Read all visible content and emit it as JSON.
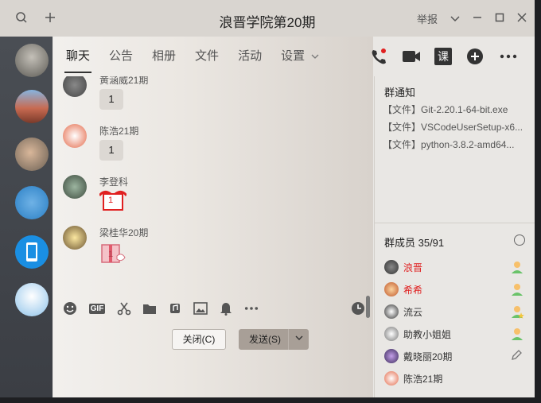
{
  "window": {
    "title": "浪晋学院第20期",
    "report_label": "举报"
  },
  "tabs": [
    {
      "label": "聊天"
    },
    {
      "label": "公告"
    },
    {
      "label": "相册"
    },
    {
      "label": "文件"
    },
    {
      "label": "活动"
    },
    {
      "label": "设置"
    }
  ],
  "header_icons": [
    "phone-icon",
    "video-icon",
    "course-icon",
    "add-icon",
    "more-icon"
  ],
  "header_course_label": "课",
  "messages": [
    {
      "name": "黄涵威21期",
      "content": "1",
      "type": "text"
    },
    {
      "name": "陈浩21期",
      "content": "1",
      "type": "text"
    },
    {
      "name": "李登科",
      "content": "1",
      "type": "gift"
    },
    {
      "name": "梁桂华20期",
      "content": "1",
      "type": "gift"
    }
  ],
  "composer": {
    "tools": [
      "emoji-icon",
      "gif-icon",
      "scissors-icon",
      "folder-icon",
      "music-icon",
      "image-icon",
      "bell-icon",
      "more-icon",
      "clock-icon"
    ],
    "gif_label": "GIF",
    "close_label": "关闭(C)",
    "send_label": "发送(S)"
  },
  "notice": {
    "title": "群通知",
    "files": [
      {
        "prefix": "【文件】",
        "name": "Git-2.20.1-64-bit.exe"
      },
      {
        "prefix": "【文件】",
        "name": "VSCodeUserSetup-x6..."
      },
      {
        "prefix": "【文件】",
        "name": "python-3.8.2-amd64..."
      }
    ]
  },
  "members": {
    "title": "群成员 35/91",
    "list": [
      {
        "name": "浪晋",
        "red": true
      },
      {
        "name": "希希",
        "red": true
      },
      {
        "name": "流云",
        "red": false
      },
      {
        "name": "助教小姐姐",
        "red": false
      },
      {
        "name": "戴晓丽20期",
        "red": false
      },
      {
        "name": "陈浩21期",
        "red": false
      }
    ]
  }
}
